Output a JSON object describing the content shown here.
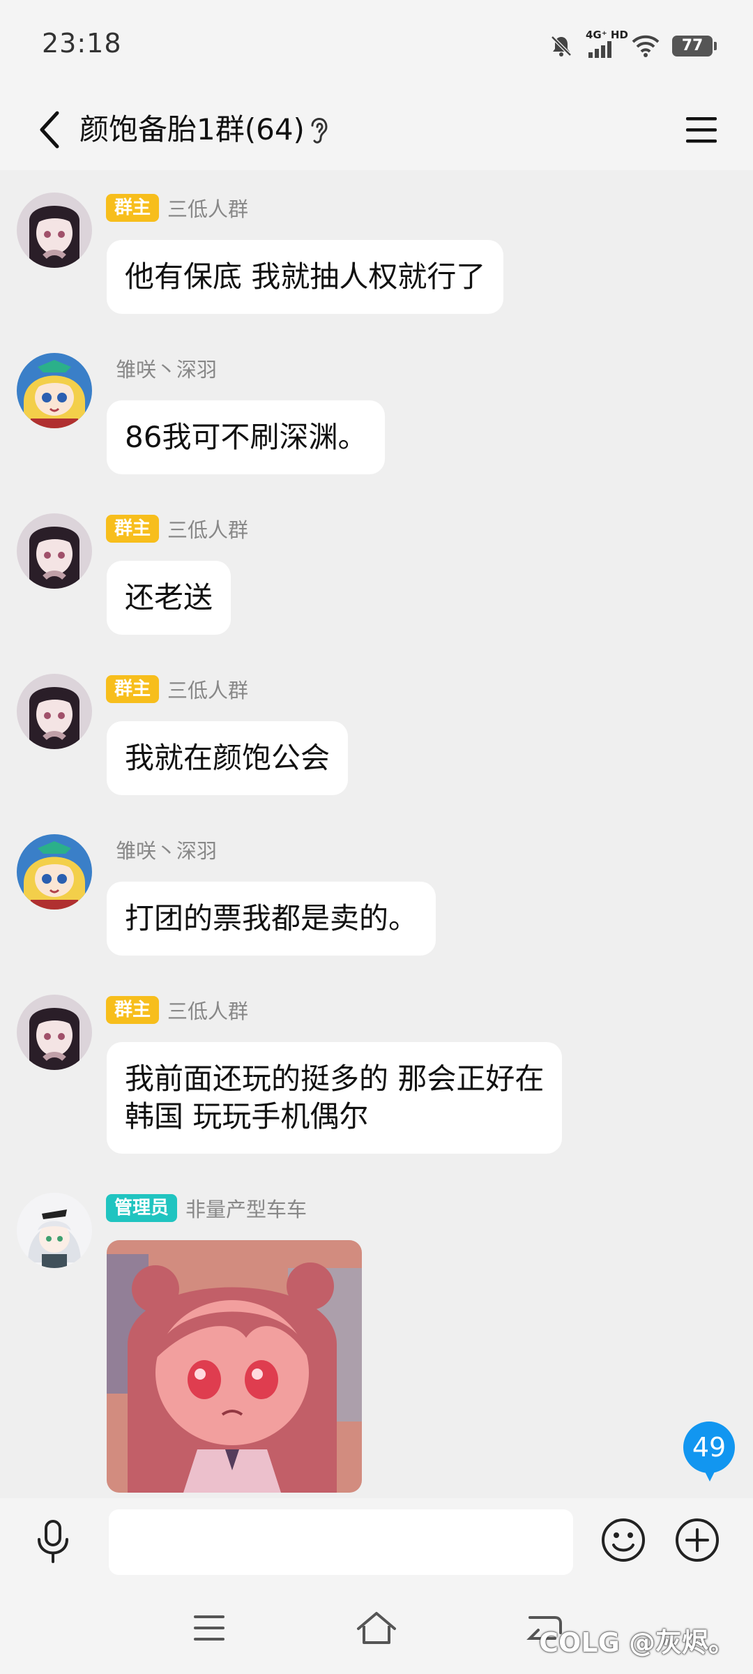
{
  "status_bar": {
    "time": "23:18",
    "network": "4G⁺ HD",
    "battery": "77"
  },
  "header": {
    "title": "颜饱备胎1群(64)"
  },
  "messages": [
    {
      "badge": "群主",
      "sender": "三低人群",
      "text": "他有保底 我就抽人权就行了"
    },
    {
      "badge": "",
      "sender": "雏咲丶深羽",
      "text": "86我可不刷深渊。"
    },
    {
      "badge": "群主",
      "sender": "三低人群",
      "text": "还老送"
    },
    {
      "badge": "群主",
      "sender": "三低人群",
      "text": "我就在颜饱公会"
    },
    {
      "badge": "",
      "sender": "雏咲丶深羽",
      "text": "打团的票我都是卖的。"
    },
    {
      "badge": "群主",
      "sender": "三低人群",
      "text": "我前面还玩的挺多的 那会正好在",
      "text2": "韩国 玩玩手机偶尔"
    },
    {
      "badge": "管理员",
      "sender": "非量产型车车",
      "text": ""
    }
  ],
  "unread_count": "49",
  "input": {
    "placeholder": ""
  },
  "watermark": "COLG @灰烬。",
  "colors": {
    "owner_badge": "#f7be1c",
    "admin_badge": "#20c4c0",
    "unread": "#1296f0",
    "background": "#efefef"
  },
  "icons": [
    "back-icon",
    "ear-icon",
    "menu-icon",
    "mic-icon",
    "emoji-icon",
    "plus-icon",
    "nav-menu-icon",
    "nav-home-icon",
    "nav-back-icon",
    "mute-icon",
    "signal-icon",
    "wifi-icon"
  ]
}
